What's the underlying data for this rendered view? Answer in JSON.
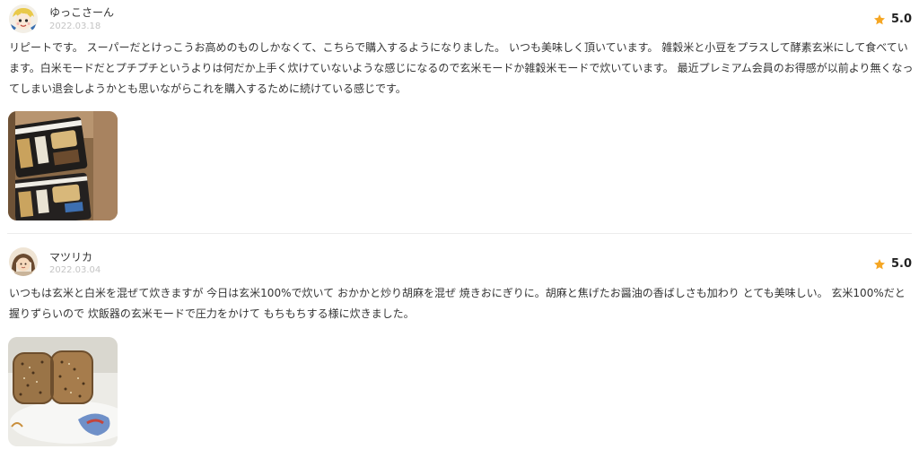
{
  "reviews": [
    {
      "username": "ゆっこさーん",
      "date": "2022.03.18",
      "rating": "5.0",
      "text": "リピートです。 スーパーだとけっこうお高めのものしかなくて、こちらで購入するようになりました。 いつも美味しく頂いています。 雑穀米と小豆をプラスして酵素玄米にして食べています。白米モードだとプチプチというよりは何だか上手く炊けていないような感じになるので玄米モードか雑穀米モードで炊いています。 最近プレミアム会員のお得感が以前より無くなってしまい退会しようかとも思いながらこれを購入するために続けている感じです。",
      "avatar_icon": "cartoon-character-avatar",
      "photo_icon": "rice-package-photo"
    },
    {
      "username": "マツリカ",
      "date": "2022.03.04",
      "rating": "5.0",
      "text": "いつもは玄米と白米を混ぜて炊きますが 今日は玄米100%で炊いて おかかと炒り胡麻を混ぜ 焼きおにぎりに。胡麻と焦げたお醤油の香ばしさも加わり とても美味しい。 玄米100%だと握りずらいので 炊飯器の玄米モードで圧力をかけて もちもちする様に炊きました。",
      "avatar_icon": "person-avatar",
      "photo_icon": "grilled-rice-ball-photo"
    }
  ],
  "colors": {
    "star": "#f5a623",
    "date": "#c4c4c4",
    "text": "#333333",
    "divider": "#ececec"
  }
}
